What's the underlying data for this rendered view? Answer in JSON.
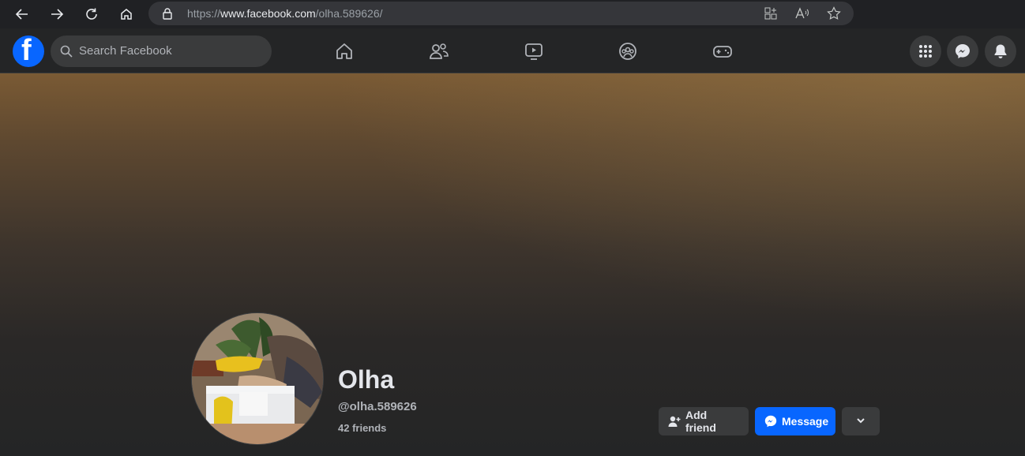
{
  "browser": {
    "url_prefix": "https://",
    "url_host": "www.facebook.com",
    "url_path": "/olha.589626/"
  },
  "header": {
    "logo": "f",
    "search_placeholder": "Search Facebook"
  },
  "profile": {
    "name": "Olha",
    "handle": "@olha.589626",
    "friends": "42 friends"
  },
  "actions": {
    "add_friend": "Add friend",
    "message": "Message"
  },
  "colors": {
    "accent": "#0866ff",
    "surface": "#242526",
    "button": "#3a3b3c"
  },
  "icons": [
    "back-icon",
    "forward-icon",
    "refresh-icon",
    "home-icon",
    "lock-icon",
    "grid-icon",
    "read-aloud-icon",
    "favorite-icon",
    "search-icon",
    "nav-home-icon",
    "friends-icon",
    "watch-icon",
    "groups-icon",
    "gaming-icon",
    "menu-grid-icon",
    "messenger-icon",
    "bell-icon",
    "add-friend-icon",
    "chevron-down-icon"
  ]
}
